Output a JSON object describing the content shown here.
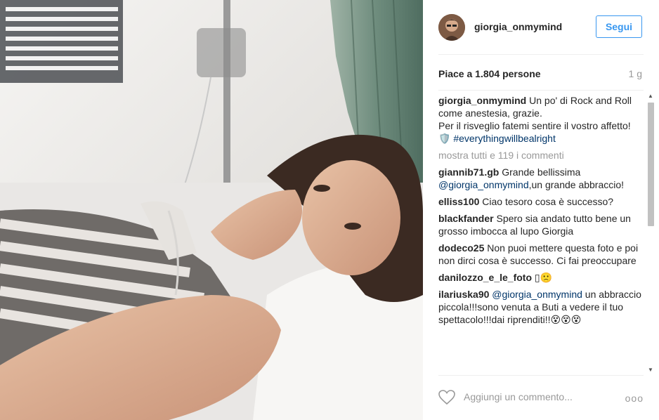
{
  "post": {
    "username": "giorgia_onmymind",
    "follow_label": "Segui",
    "likes_text": "Piace a 1.804 persone",
    "time_ago": "1 g"
  },
  "caption": {
    "author": "giorgia_onmymind",
    "text_1": "Un po' di Rock and Roll come anestesia, grazie.",
    "text_2": "Per il risveglio fatemi sentire il vostro affetto! 🛡️ ",
    "hashtag": "#everythingwillbealright"
  },
  "show_all_comments": "mostra tutti e 119 i commenti",
  "comments": [
    {
      "author": "giannib71.gb",
      "text_before": "Grande bellissima ",
      "mention": "@giorgia_onmymind",
      "text_after": ",un grande abbraccio!"
    },
    {
      "author": "elliss100",
      "text_before": "Ciao tesoro cosa è successo?",
      "mention": "",
      "text_after": ""
    },
    {
      "author": "blackfander",
      "text_before": "Spero sia andato tutto bene un grosso imbocca al lupo Giorgia",
      "mention": "",
      "text_after": ""
    },
    {
      "author": "dodeco25",
      "text_before": "Non puoi mettere questa foto e poi non dirci cosa è successo. Ci fai preoccupare",
      "mention": "",
      "text_after": ""
    },
    {
      "author": "danilozzo_e_le_foto",
      "text_before": "▯🙁",
      "mention": "",
      "text_after": ""
    },
    {
      "author": "ilariuska90",
      "text_before": "",
      "mention": "@giorgia_onmymind",
      "text_after": " un abbraccio piccola!!!sono venuta a Buti a vedere il tuo spettacolo!!!dai riprenditi!!😵😵😵"
    }
  ],
  "footer": {
    "add_comment_placeholder": "Aggiungi un commento...",
    "more_label": "ooo"
  },
  "colors": {
    "accent": "#3897f0",
    "link": "#003569",
    "muted": "#999999"
  }
}
